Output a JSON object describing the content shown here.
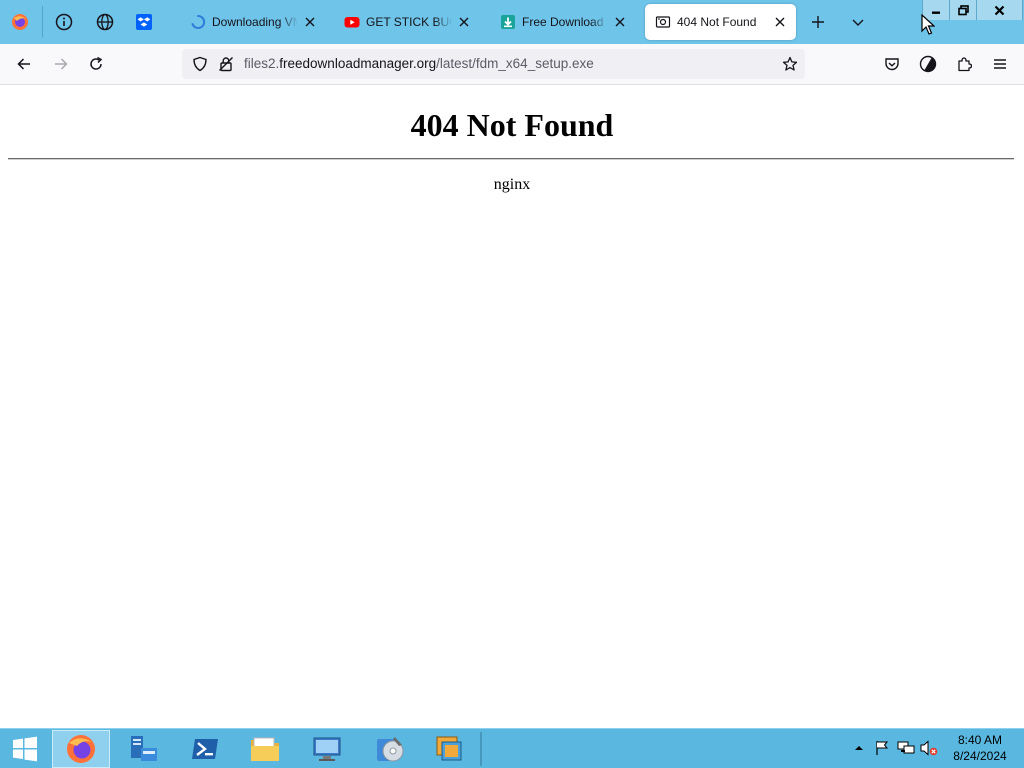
{
  "browser": {
    "tabs": [
      {
        "title": "Downloading VMware",
        "favicon": "spinner-icon"
      },
      {
        "title": "GET STICK BUGGED LOL",
        "favicon": "youtube-icon"
      },
      {
        "title": "Free Download Manager",
        "favicon": "fdm-icon"
      },
      {
        "title": "404 Not Found",
        "favicon": "page-icon",
        "active": true
      }
    ],
    "pinned": [
      "firefox-logo-icon",
      "info-icon",
      "globe-icon",
      "dropbox-icon"
    ],
    "url": {
      "prefix": "files2.",
      "domain": "freedownloadmanager.org",
      "path": "/latest/fdm_x64_setup.exe"
    }
  },
  "page": {
    "heading": "404 Not Found",
    "server": "nginx"
  },
  "taskbar": {
    "time": "8:40 AM",
    "date": "8/24/2024"
  },
  "colors": {
    "tabbar": "#6fc4ea",
    "taskbar": "#5ab8e0",
    "navbar": "#f9f9fb"
  }
}
